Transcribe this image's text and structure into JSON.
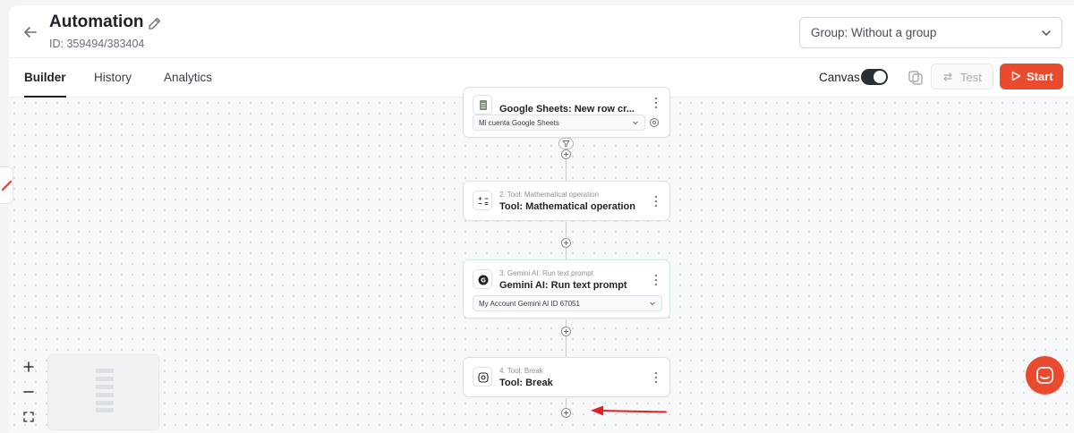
{
  "header": {
    "title": "Automation",
    "id_text": "ID: 359494/383404",
    "group_select": "Group: Without a group"
  },
  "tabs": [
    {
      "label": "Builder",
      "active": true
    },
    {
      "label": "History",
      "active": false
    },
    {
      "label": "Analytics",
      "active": false
    }
  ],
  "toolbar": {
    "canvas_label": "Canvas",
    "canvas_toggle_on": true,
    "test_label": "Test",
    "start_label": "Start"
  },
  "nodes": [
    {
      "title": "Google Sheets: New row cr...",
      "dropdown": "Mi cuenta Google Sheets",
      "icon": "sheets-icon"
    },
    {
      "subtitle": "2. Tool: Mathematical operation",
      "title": "Tool: Mathematical operation",
      "icon": "math-icon"
    },
    {
      "subtitle": "3. Gemini AI: Run text prompt",
      "title": "Gemini AI: Run text prompt",
      "dropdown": "My Account Gemini AI ID 67051",
      "icon": "gemini-icon"
    },
    {
      "subtitle": "4. Tool: Break",
      "title": "Tool: Break",
      "icon": "break-icon"
    }
  ],
  "colors": {
    "accent": "#ea4b2e",
    "annotation_arrow": "#e02020"
  }
}
